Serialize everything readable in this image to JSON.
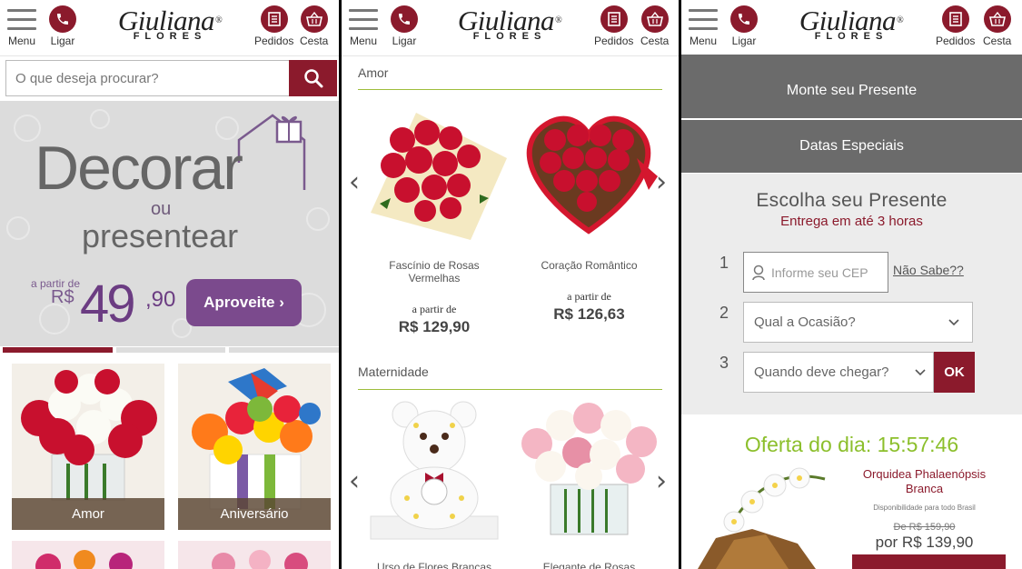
{
  "header": {
    "menu_label": "Menu",
    "ligar_label": "Ligar",
    "pedidos_label": "Pedidos",
    "cesta_label": "Cesta",
    "logo_name": "Giuliana",
    "logo_reg": "®",
    "logo_sub": "FLORES",
    "accent_color": "#8b1a2c"
  },
  "home": {
    "search": {
      "placeholder": "O que deseja procurar?"
    },
    "banner": {
      "title": "Decorar",
      "ou": "ou",
      "subtitle": "presentear",
      "price_prefix": "a partir de",
      "currency": "R$",
      "price_int": "49",
      "price_cents": ",90",
      "cta": "Aproveite ›"
    },
    "categories": [
      {
        "label": "Amor"
      },
      {
        "label": "Aniversário"
      }
    ]
  },
  "catalog": {
    "sections": [
      {
        "title": "Amor",
        "products": [
          {
            "name_line1": "Fascínio de Rosas",
            "name_line2": "Vermelhas",
            "from": "a partir de",
            "price": "R$ 129,90"
          },
          {
            "name_line1": "Coração Romântico",
            "name_line2": "",
            "from": "a partir de",
            "price": "R$ 126,63"
          }
        ]
      },
      {
        "title": "Maternidade",
        "products": [
          {
            "name_line1": "Urso de Flores Brancas"
          },
          {
            "name_line1": "Elegante de Rosas"
          }
        ]
      }
    ]
  },
  "menu_panel": {
    "items": [
      "Monte seu Presente",
      "Datas Especiais"
    ],
    "form": {
      "title": "Escolha seu Presente",
      "subtitle": "Entrega em até 3 horas",
      "steps": [
        "1",
        "2",
        "3"
      ],
      "cep_placeholder": "Informe seu CEP",
      "cep_help": "Não Sabe??",
      "ocasiao": "Qual a Ocasião?",
      "quando": "Quando deve chegar?",
      "ok": "OK"
    },
    "offer": {
      "label": "Oferta do dia: 15:57:46",
      "name_line1": "Orquidea Phalaenópsis",
      "name_line2": "Branca",
      "availability": "Disponibilidade para todo Brasil",
      "old_price": "De R$ 159,90",
      "new_price": "por R$ 139,90",
      "highlight_color": "#8cbf2c"
    }
  }
}
